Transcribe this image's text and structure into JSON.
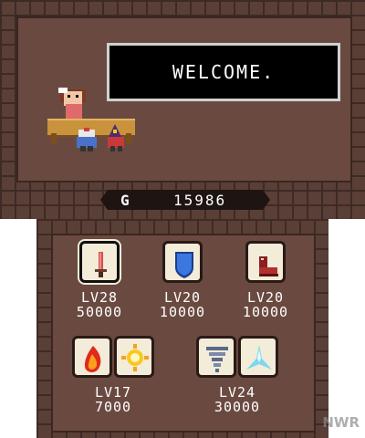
{
  "top": {
    "dialog_text": "WELCOME.",
    "gold_label": "G",
    "gold_amount": "15986"
  },
  "shop": {
    "items": [
      {
        "icon": "sword-icon",
        "level": "LV28",
        "cost": "50000"
      },
      {
        "icon": "shield-icon",
        "level": "LV20",
        "cost": "10000"
      },
      {
        "icon": "boots-icon",
        "level": "LV20",
        "cost": "10000"
      }
    ],
    "magic": [
      {
        "icons": [
          "fire-magic-icon",
          "light-magic-icon"
        ],
        "level": "LV17",
        "cost": "7000"
      },
      {
        "icons": [
          "wind-magic-icon",
          "ice-magic-icon"
        ],
        "level": "LV24",
        "cost": "30000"
      }
    ]
  },
  "watermark": "NWR"
}
